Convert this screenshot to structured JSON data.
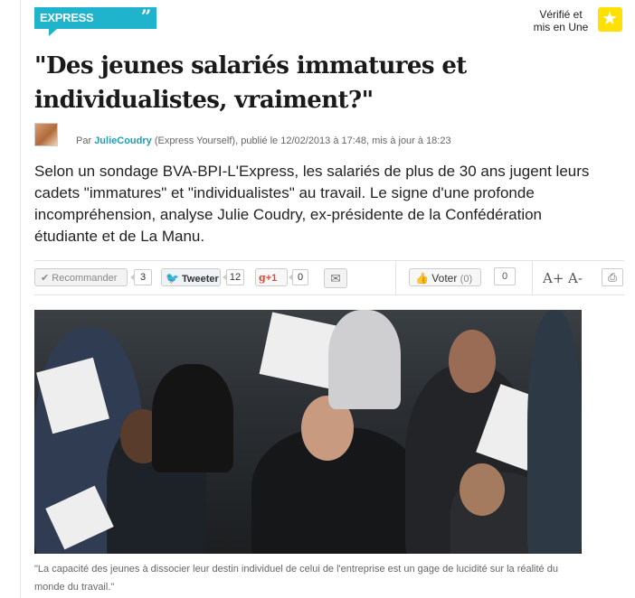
{
  "section": {
    "label": "EXPRESS YOURSELF",
    "quote_glyph": "”"
  },
  "verified": {
    "line1": "Vérifié et",
    "line2": "mis en Une",
    "icon": "star-icon"
  },
  "article": {
    "title": "\"Des jeunes salariés immatures et individualistes, vraiment?\"",
    "byline": {
      "prefix": "Par",
      "author": "JulieCoudry",
      "suffix": "(Express Yourself), publié le 12/02/2013 à 17:48, mis à jour à 18:23"
    },
    "lede": "Selon un sondage BVA-BPI-L'Express, les salariés de plus de 30 ans jugent leurs cadets \"immatures\" et \"individualistes\" au travail. Le signe d'une profonde incompréhension, analyse Julie Coudry, ex-présidente de la Confédération étudiante et de La Manu.",
    "caption": "\"La capacité des jeunes à dissocier leur destin individuel de celui de l'entreprise est un gage de lucidité sur la réalité du monde du travail.\""
  },
  "toolbar": {
    "recommander": {
      "label": "Recommander",
      "count": "3"
    },
    "tweeter": {
      "label": "Tweeter",
      "count": "12"
    },
    "gplus": {
      "label": "+1",
      "count": "0"
    },
    "voter": {
      "label": "Voter",
      "count": "(0)"
    },
    "comments": {
      "count": "0"
    },
    "font_increase": "A+",
    "font_decrease": "A-"
  },
  "colors": {
    "accent": "#1fb3cc",
    "author_link": "#1e9eb9",
    "star": "#ffe000",
    "gplus": "#dd4b39",
    "twitter": "#2ba9e1"
  }
}
